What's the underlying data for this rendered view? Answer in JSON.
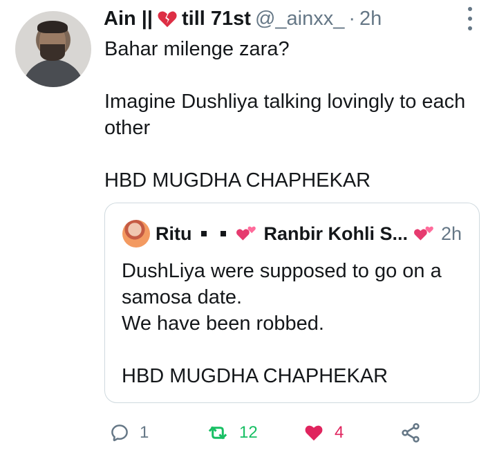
{
  "tweet": {
    "author_name": "Ain ||",
    "author_name_suffix": "till 71st",
    "handle": "@_ainxx_",
    "separator": "·",
    "time": "2h",
    "lines": [
      "Bahar milenge zara?",
      "Imagine Dushliya talking lovingly to each other",
      "HBD MUGDHA CHAPHEKAR"
    ],
    "icons": {
      "broken_heart": "broken-heart-icon",
      "more": "more-icon"
    }
  },
  "quoted_tweet": {
    "author_name": "Ritu",
    "display_name": "Ranbir Kohli S...",
    "time": "2h",
    "lines": [
      "DushLiya were supposed to go on a samosa date.",
      "We have been robbed.",
      "HBD MUGDHA CHAPHEKAR"
    ]
  },
  "actions": {
    "reply_count": "1",
    "retweet_count": "12",
    "like_count": "4",
    "share_label": ""
  },
  "colors": {
    "text": "#14171a",
    "secondary": "#657786",
    "retweet": "#17bf63",
    "like": "#e0245e",
    "border": "#cfd9de"
  }
}
